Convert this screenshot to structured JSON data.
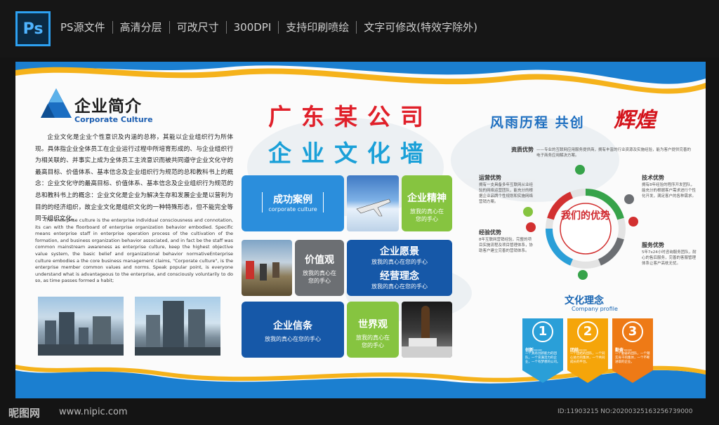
{
  "header": {
    "app_icon": "Ps",
    "features": [
      "PS源文件",
      "高清分层",
      "可改尺寸",
      "300DPI",
      "支持印刷喷绘",
      "文字可修改(特效字除外)"
    ]
  },
  "intro": {
    "title": "企业简介",
    "subtitle": "Corporate Culture",
    "cn_text": "企业文化是企业个性意识及内涵的总称，其能以企业组织行为所体现。具体指企业全体员工在企业运行过程中所培育形成的、与企业组织行为相关联的、并事实上成为全体员工主流意识而被共同遵守企业文化守的最高目标、价值体系、基本信念及企业组织行为规范的总和教科书上的概念：企业文化守的最高目标、价值体系、基本信念及企业组织行为规范的总和教科书上的概念：企业文化是企业为解决生存和发展企业是以营利为目的的经济组织，故企业文化是组织文化的一种特殊形态，但不能完全等同于组织文化。",
    "en_text": "The enterprise culture is the enterprise individual consciousness and connotation, its can with the floorboard of enterprise organization behavior embodied. Specific means enterprise staff in enterprise operation process of the cultivation of the formation, and business organization behavior associated, and in fact be the staff was common mainstream awareness as enterprise culture, keep the highest objective value system, the basic belief and organizational behavior normativeEnterprise culture embodies a the core business management claims, \"Corporate culture\", is the enterprise member common values and norms. Speak popular point, is everyone understand what is advantageous to the enterprise, and consciously voluntarily to do so, as time passes formed a habit;"
  },
  "middle": {
    "title_line1": "广东某公司",
    "title_line2": "企业文化墙",
    "tiles": {
      "case_title": "成功案例",
      "case_sub": "corporate culture",
      "spirit_title": "企业精神",
      "spirit_sub": "放我的真心在您的手心",
      "values_title": "价值观",
      "values_sub": "放我的真心在您的手心",
      "vision_title": "企业愿景",
      "vision_sub": "放我的真心在您的手心",
      "philosophy_title": "经营理念",
      "philosophy_sub": "放我的真心在您的手心",
      "creed_title": "企业信条",
      "creed_sub": "放我的真心在您的手心",
      "world_title": "世界观",
      "world_sub": "放我的真心在您的手心"
    }
  },
  "right": {
    "title": "风雨历程  共创",
    "title_red": "辉煌",
    "center": "我们的优势",
    "advantages": [
      {
        "label": "资质优势",
        "text": "——专业的互联网应用服务提供商，拥有丰富的行业资源及实施经验，能为客户提供完善的电子商务应用解决方案。"
      },
      {
        "label": "运营优势",
        "text": "拥有一支具备多年互联网从业经验的网络运营团队，能充分的根据企业品牌个性规划和实施网络营销方案。"
      },
      {
        "label": "技术优势",
        "text": "拥有8年经验的程序开发团队，能充分的根据客户需求进行个性化开发，满足客户的各种需求。"
      },
      {
        "label": "经验优势",
        "text": "8年互联网营销经验，完整的项目实施流程及项目管理体系，协助客户建立完善的营销体系。"
      },
      {
        "label": "服务优势",
        "text": "5年7x24小时咨询服务团队，耐心的售后服务，完善的客服管理体系让客户高枕无忧。"
      }
    ],
    "culture_title": "文化理念",
    "culture_sub": "Company profile",
    "banners": [
      {
        "num": "1",
        "label": "创新——",
        "text": "一个具有创新能力的团队，一个充满活力的企业，一个有梦想的公司。",
        "color": "#2a9fd8"
      },
      {
        "num": "2",
        "label": "团结——",
        "text": "一个团结的团队，一个同心协力的集体，一个共同成长的平台。",
        "color": "#f5a50a"
      },
      {
        "num": "3",
        "label": "勤奋——",
        "text": "一个勤奋的团队，一个踏实肯干的集体，一个不断进取的企业。",
        "color": "#ee7a16"
      }
    ],
    "icon_colors": [
      "#2a9fd8",
      "#37a34a",
      "#86c440",
      "#d23030",
      "#6c6f73"
    ]
  },
  "footer": {
    "brand": "昵图网",
    "url": "www.nipic.com",
    "id": "ID:11903215 NO:20200325163256739000"
  }
}
